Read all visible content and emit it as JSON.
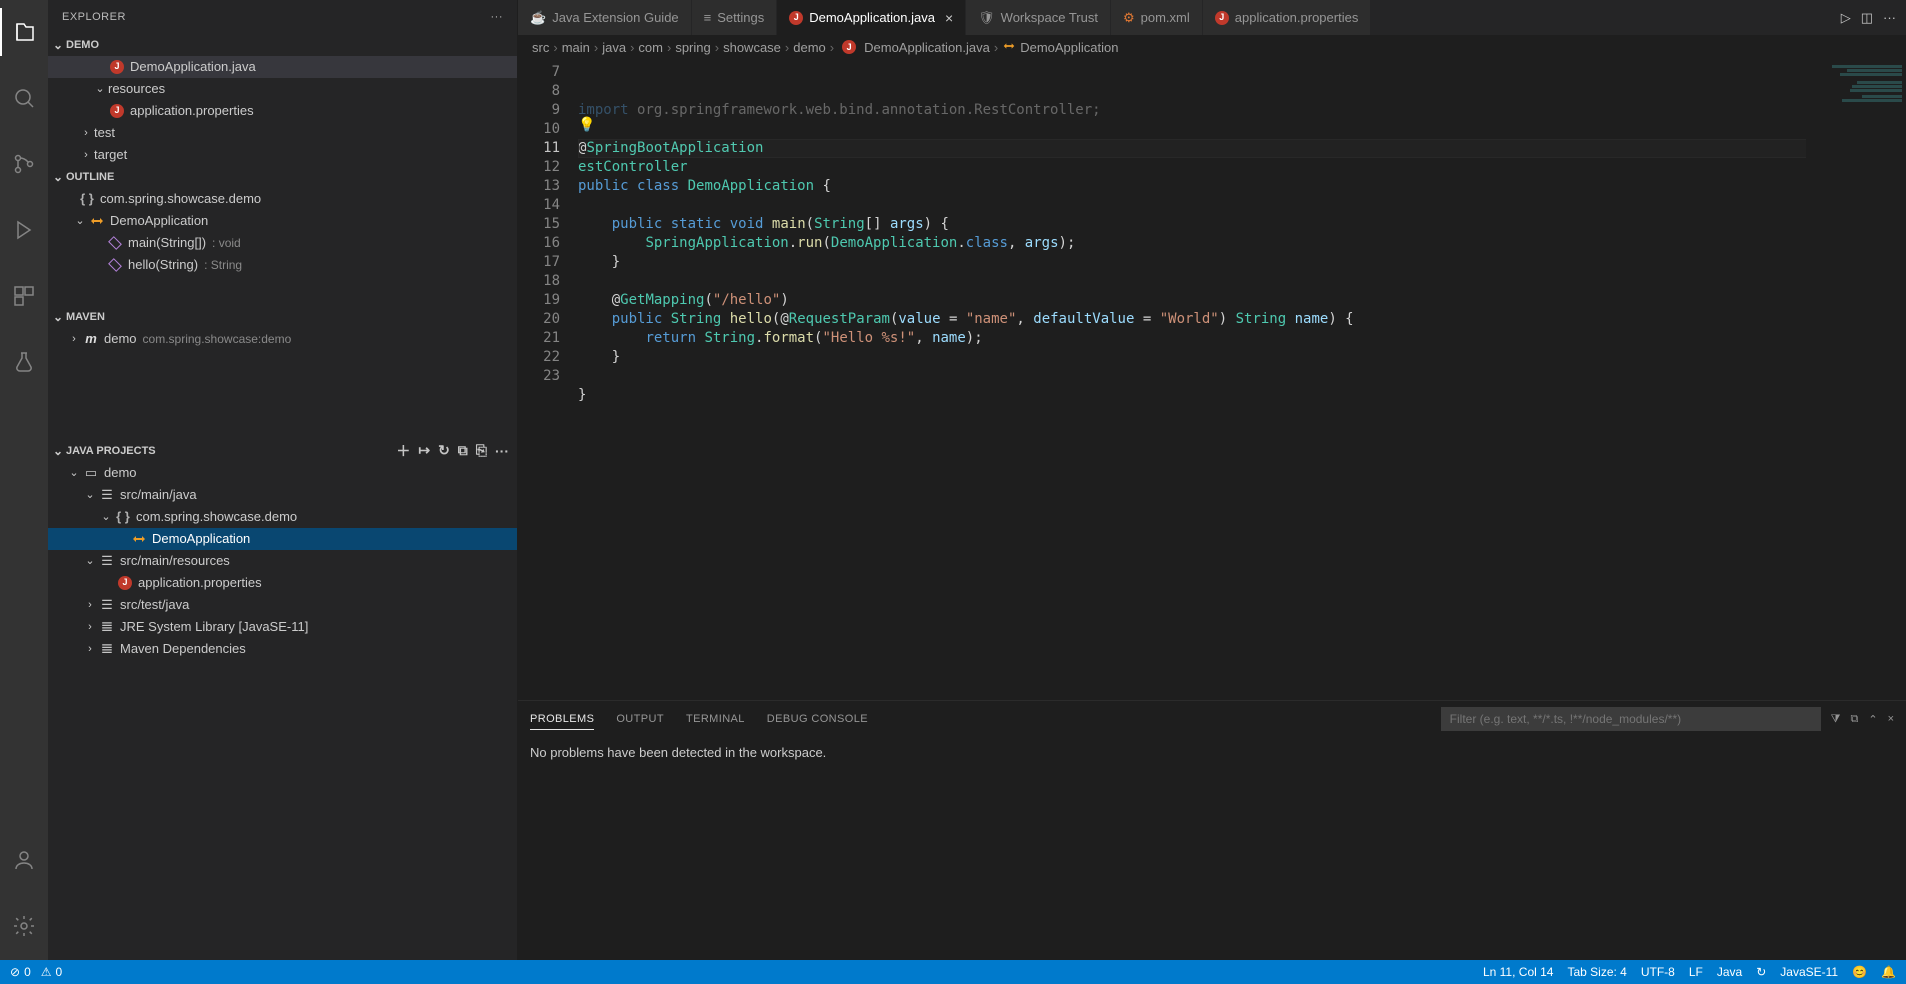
{
  "sidebar_title": "EXPLORER",
  "sections": {
    "demo": "DEMO",
    "outline": "OUTLINE",
    "maven": "MAVEN",
    "javaproj": "JAVA PROJECTS"
  },
  "demo_tree": {
    "file1": "DemoApplication.java",
    "folder_res": "resources",
    "file2": "application.properties",
    "folder_test": "test",
    "folder_target": "target"
  },
  "outline": {
    "ns": "com.spring.showcase.demo",
    "class": "DemoApplication",
    "m1": "main(String[])",
    "m1t": ": void",
    "m2": "hello(String)",
    "m2t": ": String"
  },
  "maven": {
    "proj": "demo",
    "coords": "com.spring.showcase:demo"
  },
  "javaproj": {
    "root": "demo",
    "srcmain": "src/main/java",
    "pkg": "com.spring.showcase.demo",
    "class": "DemoApplication",
    "srcres": "src/main/resources",
    "appprops": "application.properties",
    "srctest": "src/test/java",
    "jre": "JRE System Library [JavaSE-11]",
    "mvn": "Maven Dependencies"
  },
  "tabs": {
    "t1": "Java Extension Guide",
    "t2": "Settings",
    "t3": "DemoApplication.java",
    "t4": "Workspace Trust",
    "t5": "pom.xml",
    "t6": "application.properties"
  },
  "breadcrumb": [
    "src",
    "main",
    "java",
    "com",
    "spring",
    "showcase",
    "demo",
    "DemoApplication.java",
    "DemoApplication"
  ],
  "code": {
    "line7": "import org.springframework.web.bind.annotation.RestController;",
    "ann1": "SpringBootApplication",
    "ann2": "estController",
    "pub": "public",
    "cls": "class",
    "clsname": "DemoApplication",
    "static": "static",
    "void": "void",
    "main": "main",
    "string": "String",
    "args": "args",
    "springapp": "SpringApplication",
    "run": "run",
    "dotclass": "class",
    "getmap": "GetMapping",
    "hello_path": "\"/hello\"",
    "hello": "hello",
    "reqparam": "RequestParam",
    "value": "value",
    "namekey": "\"name\"",
    "defval": "defaultValue",
    "world": "\"World\"",
    "name": "name",
    "return": "return",
    "format": "format",
    "hellofmt": "\"Hello %s!\""
  },
  "line_numbers": [
    "7",
    "8",
    "9",
    "10",
    "11",
    "12",
    "13",
    "14",
    "15",
    "16",
    "17",
    "18",
    "19",
    "20",
    "21",
    "22",
    "23"
  ],
  "current_line_idx": 4,
  "panel": {
    "problems": "PROBLEMS",
    "output": "OUTPUT",
    "terminal": "TERMINAL",
    "debug": "DEBUG CONSOLE",
    "filter_ph": "Filter (e.g. text, **/*.ts, !**/node_modules/**)",
    "body": "No problems have been detected in the workspace."
  },
  "status": {
    "errors": "0",
    "warnings": "0",
    "ln": "Ln 11, Col 14",
    "tabsize": "Tab Size: 4",
    "enc": "UTF-8",
    "eol": "LF",
    "lang": "Java",
    "jdk": "JavaSE-11"
  }
}
